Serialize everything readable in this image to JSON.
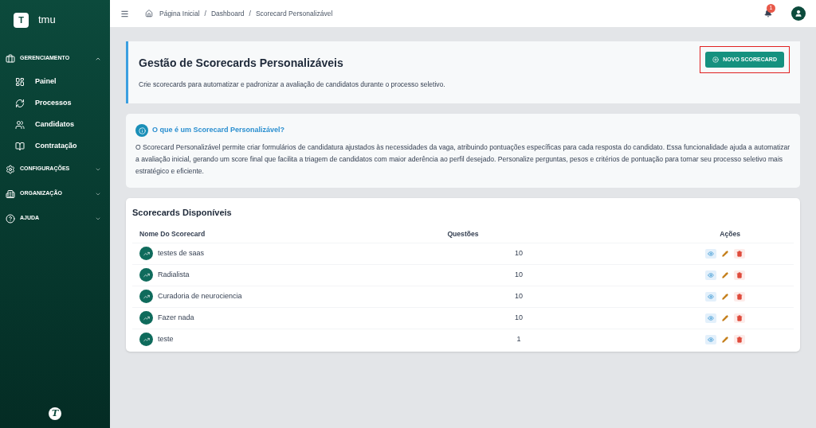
{
  "sidebar": {
    "logo_letter": "T",
    "app_name": "tmu",
    "sections": [
      {
        "label": "GERENCIAMENTO",
        "expanded": true,
        "items": [
          {
            "label": "Painel"
          },
          {
            "label": "Processos"
          },
          {
            "label": "Candidatos"
          },
          {
            "label": "Contratação"
          }
        ]
      },
      {
        "label": "CONFIGURAÇÕES",
        "expanded": false
      },
      {
        "label": "ORGANIZAÇÃO",
        "expanded": false
      },
      {
        "label": "AJUDA",
        "expanded": false
      }
    ],
    "footer_logo": "T"
  },
  "topbar": {
    "breadcrumb": [
      "Página Inicial",
      "/",
      "Dashboard",
      "/",
      "Scorecard Personalizável"
    ],
    "notification_count": "1"
  },
  "header": {
    "title": "Gestão de Scorecards Personalizáveis",
    "subtitle": "Crie scorecards para automatizar e padronizar a avaliação de candidatos durante o processo seletivo.",
    "new_button": "NOVO SCORECARD",
    "highlighted": true
  },
  "info": {
    "title": "O que é um Scorecard Personalizável?",
    "text": "O Scorecard Personalizável permite criar formulários de candidatura ajustados às necessidades da vaga, atribuindo pontuações específicas para cada resposta do candidato. Essa funcionalidade ajuda a automatizar a avaliação inicial, gerando um score final que facilita a triagem de candidatos com maior aderência ao perfil desejado. Personalize perguntas, pesos e critérios de pontuação para tornar seu processo seletivo mais estratégico e eficiente."
  },
  "table": {
    "title": "Scorecards Disponíveis",
    "columns": [
      "Nome Do Scorecard",
      "Questões",
      "Ações"
    ],
    "rows": [
      {
        "name": "testes de saas",
        "questions": "10"
      },
      {
        "name": "Radialista",
        "questions": "10"
      },
      {
        "name": "Curadoria de neurociencia",
        "questions": "10"
      },
      {
        "name": "Fazer nada",
        "questions": "10"
      },
      {
        "name": "teste",
        "questions": "1"
      }
    ]
  }
}
